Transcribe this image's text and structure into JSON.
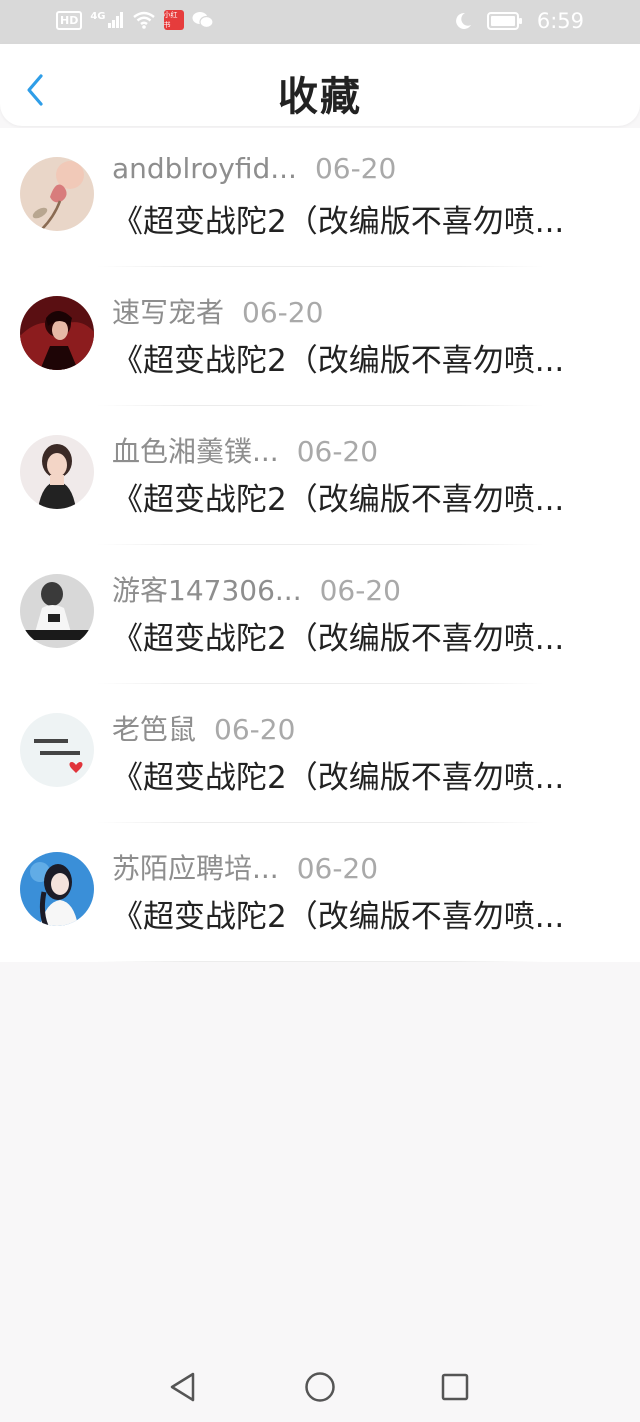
{
  "status_bar": {
    "hd": "HD",
    "network": "4G",
    "app_badge": "小红书",
    "time": "6:59",
    "icons": [
      "hd-icon",
      "signal-icon",
      "wifi-icon",
      "app-icon",
      "wechat-icon",
      "moon-icon",
      "battery-icon"
    ]
  },
  "header": {
    "back_icon": "chevron-left-icon",
    "title": "收藏",
    "accent": "#2f9ee8"
  },
  "items": [
    {
      "username": "andblroyfid...",
      "date": "06-20",
      "subject": "《超变战陀2（改编版不喜勿喷...",
      "avatar": "flower"
    },
    {
      "username": "速写宠者",
      "date": "06-20",
      "subject": "《超变战陀2（改编版不喜勿喷...",
      "avatar": "anime-dark"
    },
    {
      "username": "血色湘羹镤...",
      "date": "06-20",
      "subject": "《超变战陀2（改编版不喜勿喷...",
      "avatar": "girl"
    },
    {
      "username": "游客147306...",
      "date": "06-20",
      "subject": "《超变战陀2（改编版不喜勿喷...",
      "avatar": "bw-photo"
    },
    {
      "username": "老笆鼠",
      "date": "06-20",
      "subject": "《超变战陀2（改编版不喜勿喷...",
      "avatar": "text-heart"
    },
    {
      "username": "苏陌应聘培...",
      "date": "06-20",
      "subject": "《超变战陀2（改编版不喜勿喷...",
      "avatar": "anime-girl"
    }
  ],
  "nav": {
    "icons": [
      "back-triangle-icon",
      "home-circle-icon",
      "recents-square-icon"
    ]
  }
}
